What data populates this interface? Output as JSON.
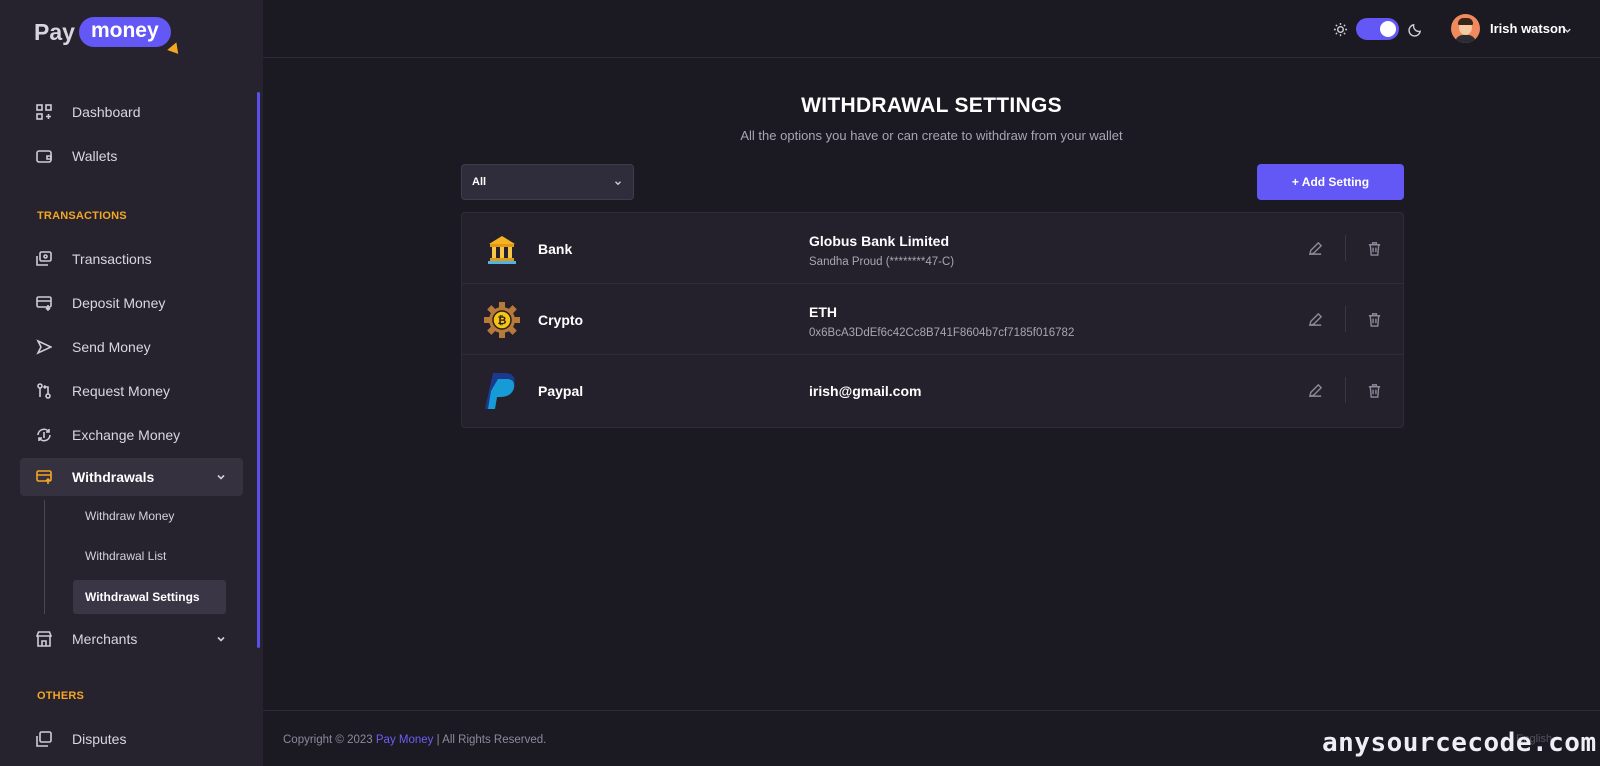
{
  "brand": {
    "logo_part1": "Pay",
    "logo_part2": "money"
  },
  "sidebar": {
    "items": [
      {
        "label": "Dashboard",
        "icon": "dashboard-icon"
      },
      {
        "label": "Wallets",
        "icon": "wallet-icon"
      },
      {
        "label": "Transactions",
        "icon": "transactions-icon"
      },
      {
        "label": "Deposit Money",
        "icon": "deposit-icon"
      },
      {
        "label": "Send Money",
        "icon": "send-icon"
      },
      {
        "label": "Request Money",
        "icon": "request-icon"
      },
      {
        "label": "Exchange Money",
        "icon": "exchange-icon"
      },
      {
        "label": "Withdrawals",
        "icon": "withdrawals-icon"
      },
      {
        "label": "Merchants",
        "icon": "merchants-icon"
      },
      {
        "label": "Disputes",
        "icon": "disputes-icon"
      }
    ],
    "sections": {
      "transactions": "TRANSACTIONS",
      "others": "OTHERS"
    },
    "withdrawals_sub": [
      "Withdraw Money",
      "Withdrawal List",
      "Withdrawal Settings"
    ],
    "active_item": "Withdrawals",
    "active_sub": "Withdrawal Settings"
  },
  "header": {
    "username": "Irish watson",
    "theme_mode": "dark"
  },
  "main": {
    "title": "WITHDRAWAL SETTINGS",
    "subtitle": "All the options you have or can create to withdraw from your wallet",
    "filter_value": "All",
    "add_button": "+ Add Setting",
    "settings": [
      {
        "type": "Bank",
        "main": "Globus Bank Limited",
        "sub": "Sandha Proud (********47-C)",
        "icon": "bank-icon"
      },
      {
        "type": "Crypto",
        "main": "ETH",
        "sub": "0x6BcA3DdEf6c42Cc8B741F8604b7cf7185f016782",
        "icon": "crypto-icon"
      },
      {
        "type": "Paypal",
        "main": "irish@gmail.com",
        "sub": "",
        "icon": "paypal-icon"
      }
    ]
  },
  "footer": {
    "copyright_prefix": "Copyright © 2023",
    "brand": "Pay Money",
    "suffix": "| All Rights Reserved.",
    "language": "English"
  },
  "watermark": "anysourcecode.com",
  "colors": {
    "accent": "#6357f5",
    "section_label": "#f5a623",
    "background": "#1b1922",
    "sidebar": "#26232f"
  }
}
